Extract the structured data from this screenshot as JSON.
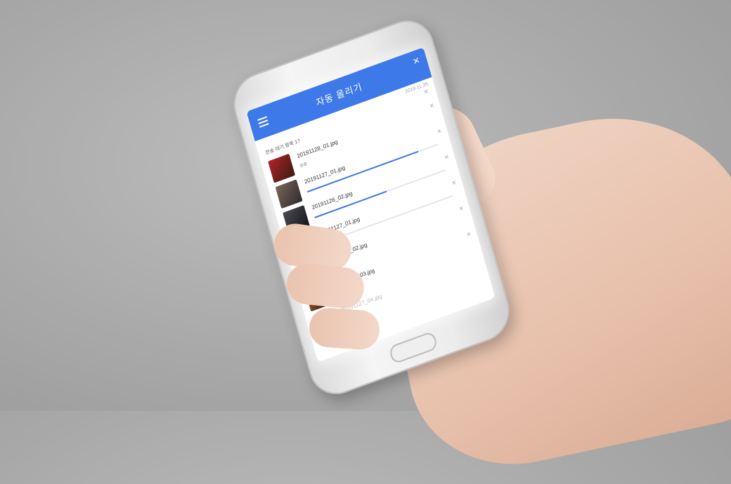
{
  "app": {
    "title": "자동 올리기",
    "date": "2019.11.26",
    "queue_label": "전송 대기 항목 17"
  },
  "colors": {
    "accent": "#3d79e8"
  },
  "items": [
    {
      "name": "20191128_01.jpg",
      "status": "완료",
      "progress": null,
      "colors": [
        "#b2222a",
        "#3b1b12"
      ]
    },
    {
      "name": "20191127_01.jpg",
      "status": "",
      "progress": 0.85,
      "colors": [
        "#7a6455",
        "#2f2a30"
      ]
    },
    {
      "name": "20191126_02.jpg",
      "status": "",
      "progress": 0.55,
      "colors": [
        "#4a4a52",
        "#141418"
      ]
    },
    {
      "name": "20191127_01.jpg",
      "status": "",
      "progress": 0.08,
      "colors": [
        "#c47b3b",
        "#3a2012"
      ]
    },
    {
      "name": "20191127_02.jpg",
      "status": "대기 중",
      "progress": null,
      "colors": [
        "#d08f3a",
        "#2a1a0d"
      ]
    },
    {
      "name": "20191127_03.jpg",
      "status": "대기 중",
      "progress": null,
      "colors": [
        "#c56a3a",
        "#1c120c"
      ]
    },
    {
      "name": "20191127_04.jpg",
      "status": "",
      "progress": null,
      "colors": [
        "#d7c6b8",
        "#a39284"
      ],
      "faded": true
    }
  ]
}
